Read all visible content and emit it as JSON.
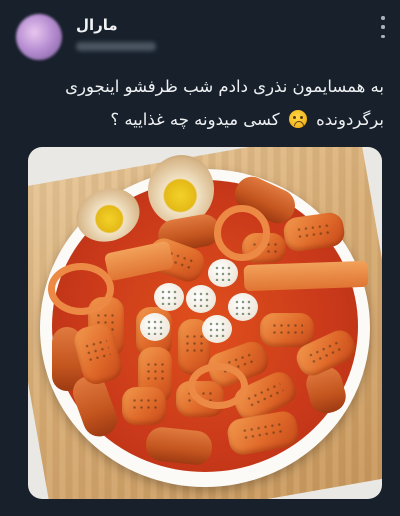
{
  "author": {
    "name": "مارال"
  },
  "tweet": {
    "line1": "به همسایمون نذری دادم شب ظرفشو اینجوری",
    "line2_before_emoji": "برگردونده",
    "line2_after_emoji": "کسی میدونه چه غذاییه ؟",
    "emoji": "weary-face-emoji"
  },
  "media": {
    "subject": "tteokbokki dish"
  },
  "colors": {
    "background": "#17202b",
    "text": "#e7e9ea",
    "sauce": "#c9391a"
  }
}
